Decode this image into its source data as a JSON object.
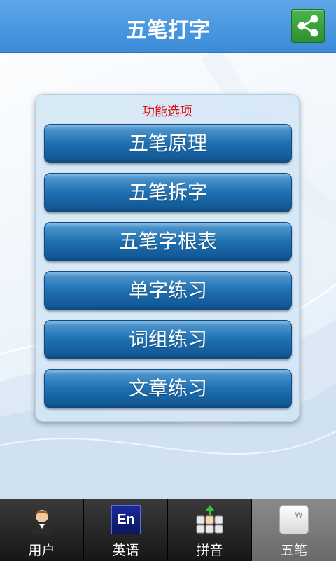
{
  "header": {
    "title": "五笔打字",
    "share_icon": "share-icon"
  },
  "panel": {
    "title": "功能选项",
    "items": [
      {
        "label": "五笔原理"
      },
      {
        "label": "五笔拆字"
      },
      {
        "label": "五笔字根表"
      },
      {
        "label": "单字练习"
      },
      {
        "label": "词组练习"
      },
      {
        "label": "文章练习"
      }
    ]
  },
  "bottom_nav": {
    "tabs": [
      {
        "label": "用户",
        "icon": "user-avatar-icon"
      },
      {
        "label": "英语",
        "icon": "english-en-icon",
        "icon_text": "En"
      },
      {
        "label": "拼音",
        "icon": "keyboard-icon"
      },
      {
        "label": "五笔",
        "icon": "key-w-icon",
        "icon_text": "W",
        "active": true
      }
    ]
  },
  "colors": {
    "header": "#3b8bd8",
    "share": "#2e8f2e",
    "panel_title": "#e01010",
    "button": "#1f6fb0",
    "nav_bg": "#1a1a1a",
    "nav_active": "#7a7a7a"
  }
}
